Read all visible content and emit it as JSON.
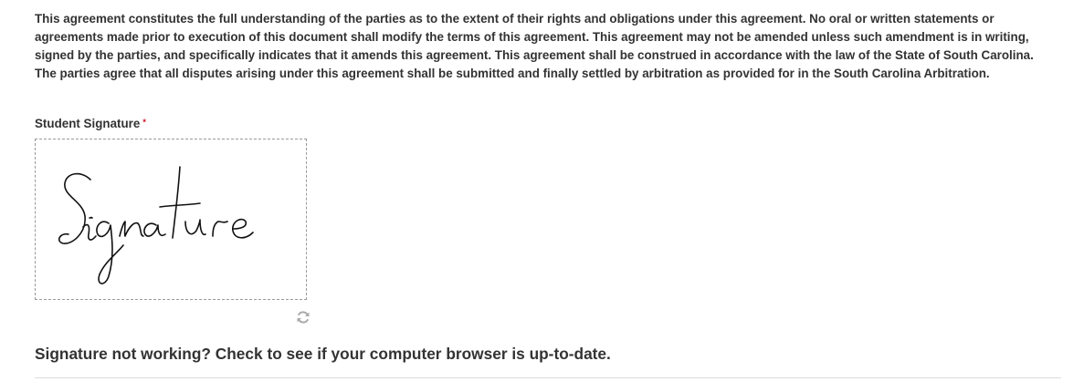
{
  "agreement": {
    "text": "This agreement constitutes the full understanding of the parties as to the extent of their rights and obligations under this agreement. No oral or written statements or agreements made prior to execution of this document shall modify the terms of this agreement. This agreement may not be amended unless such amendment is in writing, signed by the parties, and specifically indicates that it amends this agreement. This agreement shall be construed in accordance with the law of the State of South Carolina. The parties agree that all disputes arising under this agreement shall be submitted and finally settled by arbitration as provided for in the South Carolina Arbitration."
  },
  "signature_field": {
    "label": "Student Signature",
    "required_mark": "*",
    "handwritten_value": "Signature",
    "reset_icon": "refresh-icon"
  },
  "help": {
    "text": "Signature not working? Check to see if your computer browser is up-to-date."
  },
  "colors": {
    "text": "#333333",
    "required": "#d0021b",
    "pad_border": "#9a9a9a",
    "icon": "#aaaaaa",
    "divider": "#dcdcdc"
  }
}
